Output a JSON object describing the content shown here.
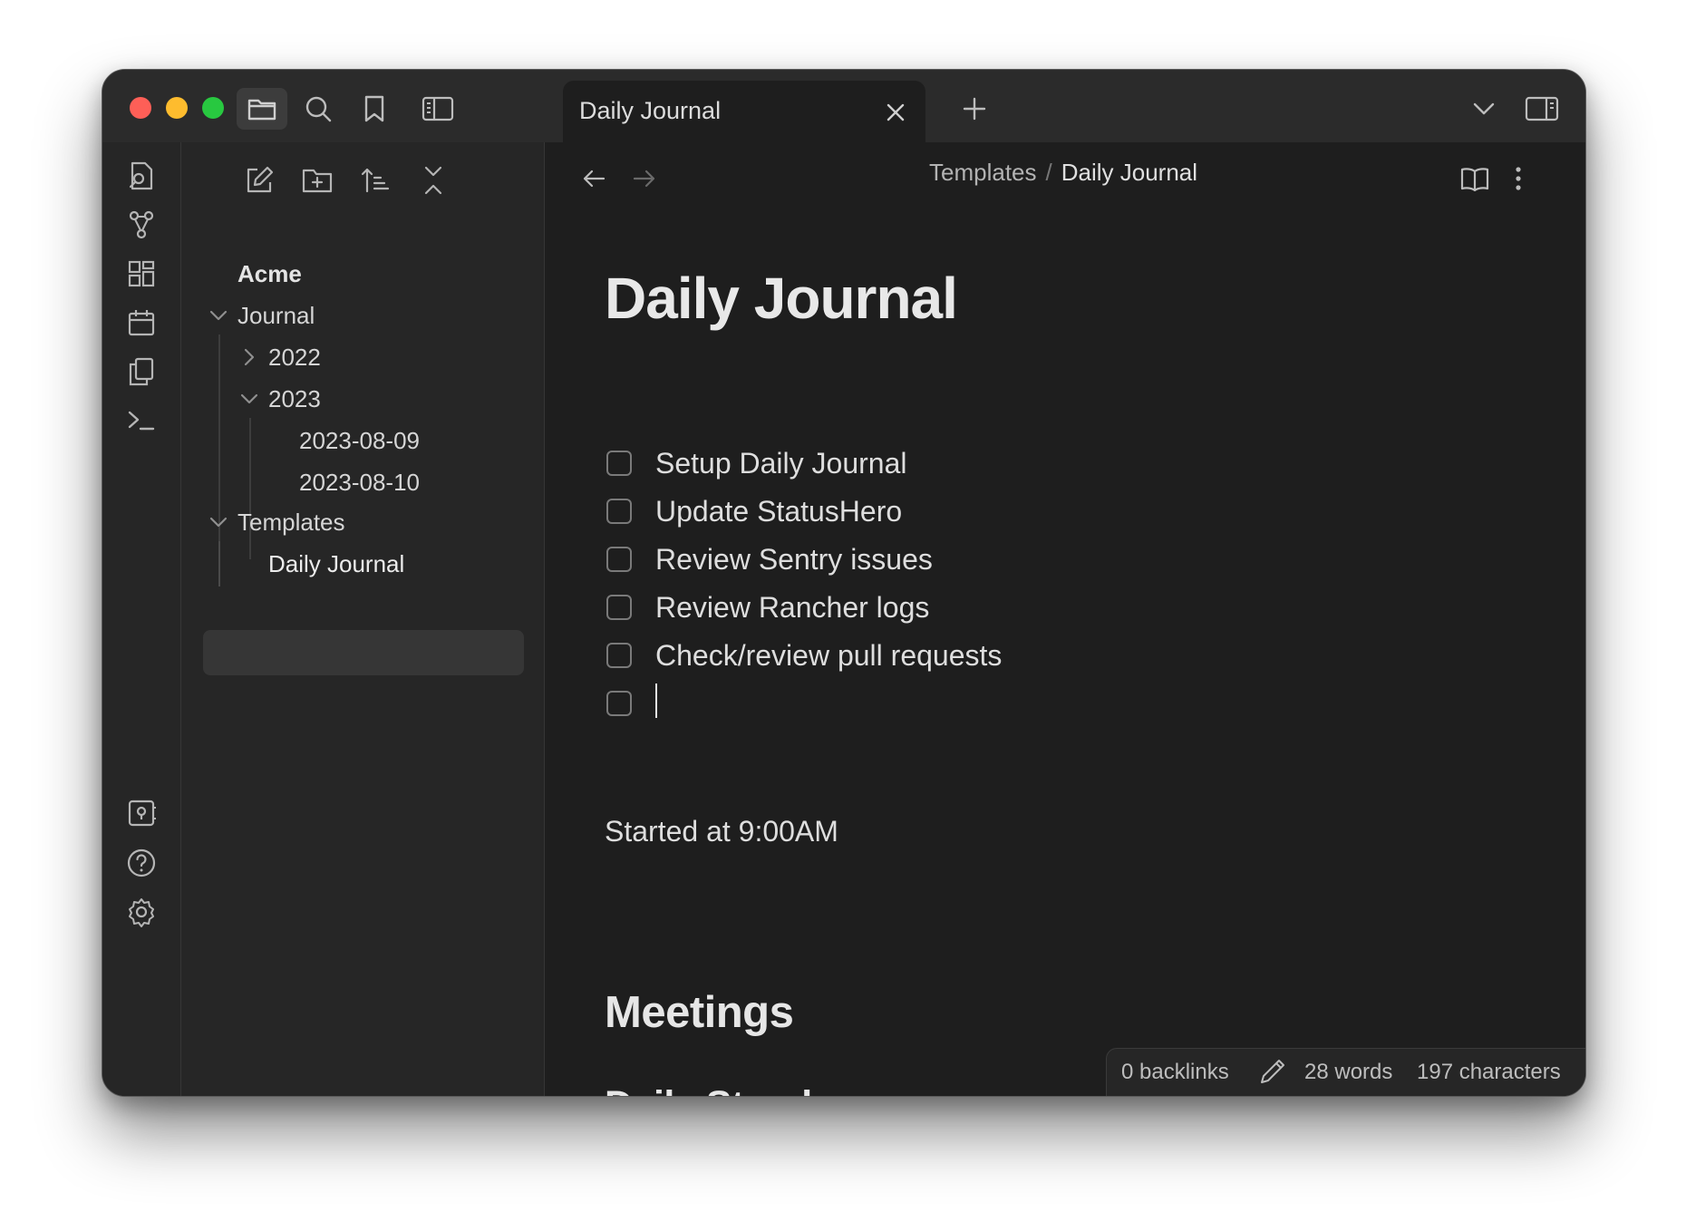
{
  "window": {
    "tab_title": "Daily Journal",
    "breadcrumb": {
      "parent": "Templates",
      "separator": "/",
      "current": "Daily Journal"
    }
  },
  "sidebar": {
    "vault_name": "Acme",
    "tree": [
      {
        "label": "Journal",
        "state": "expanded"
      },
      {
        "label": "2022",
        "state": "collapsed"
      },
      {
        "label": "2023",
        "state": "expanded"
      },
      {
        "label": "2023-08-09"
      },
      {
        "label": "2023-08-10"
      },
      {
        "label": "Templates",
        "state": "expanded"
      },
      {
        "label": "Daily Journal",
        "selected": true
      }
    ]
  },
  "editor": {
    "title": "Daily Journal",
    "tasks": [
      {
        "label": "Setup Daily Journal",
        "checked": false
      },
      {
        "label": "Update StatusHero",
        "checked": false
      },
      {
        "label": "Review Sentry issues",
        "checked": false
      },
      {
        "label": "Review Rancher logs",
        "checked": false
      },
      {
        "label": "Check/review pull requests",
        "checked": false
      },
      {
        "label": "",
        "checked": false
      }
    ],
    "paragraph": "Started at 9:00AM",
    "heading_meetings": "Meetings",
    "heading_standup": "Daily Stand-up"
  },
  "status": {
    "backlinks": "0 backlinks",
    "words": "28 words",
    "characters": "197 characters"
  },
  "colors": {
    "background": "#1e1e1e",
    "sidebar": "#262626",
    "titlebar": "#2b2b2b",
    "traffic_red": "#fe5f57",
    "traffic_yellow": "#febc2e",
    "traffic_green": "#28c840"
  }
}
